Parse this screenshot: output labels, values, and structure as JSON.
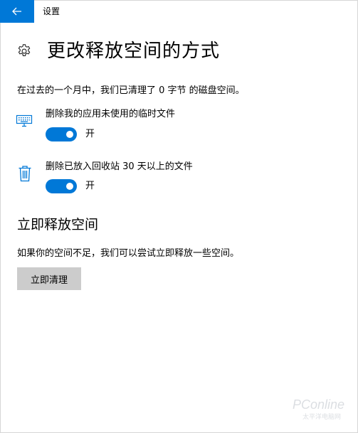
{
  "window": {
    "title": "设置",
    "accent_color": "#0078d7"
  },
  "header": {
    "title": "更改释放空间的方式",
    "icon": "gear-icon"
  },
  "intro_text": "在过去的一个月中，我们已清理了 0 字节 的磁盘空间。",
  "options": [
    {
      "icon": "keyboard-icon",
      "label": "删除我的应用未使用的临时文件",
      "toggle_on": true,
      "state_label": "开"
    },
    {
      "icon": "trash-icon",
      "label": "删除已放入回收站 30 天以上的文件",
      "toggle_on": true,
      "state_label": "开"
    }
  ],
  "free_now": {
    "title": "立即释放空间",
    "description": "如果你的空间不足，我们可以尝试立即释放一些空间。",
    "button_label": "立即清理"
  },
  "watermark": {
    "text": "PConline",
    "subtext": "太平洋电脑网"
  }
}
